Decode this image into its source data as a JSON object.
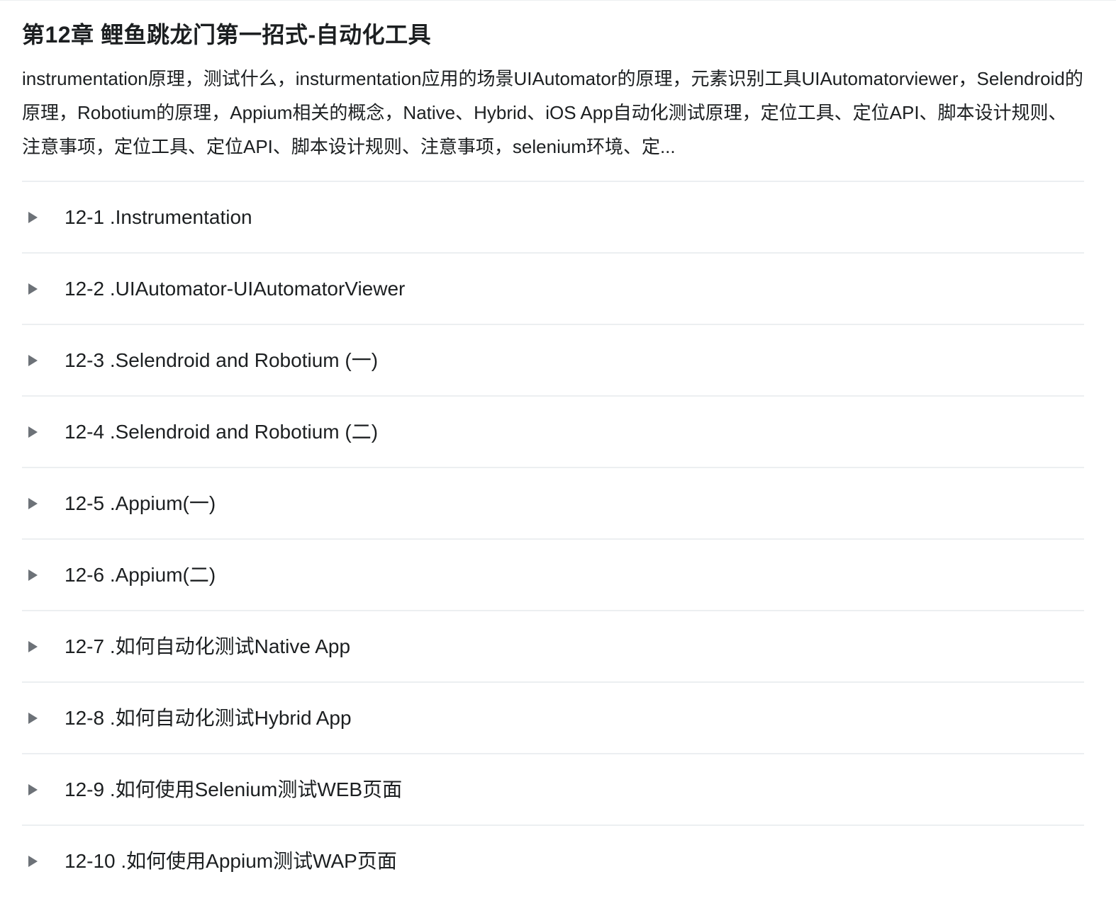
{
  "chapter": {
    "title": "第12章 鲤鱼跳龙门第一招式-自动化工具",
    "description": "instrumentation原理，测试什么，insturmentation应用的场景UIAutomator的原理，元素识别工具UIAutomatorviewer，Selendroid的原理，Robotium的原理，Appium相关的概念，Native、Hybrid、iOS App自动化测试原理，定位工具、定位API、脚本设计规则、注意事项，定位工具、定位API、脚本设计规则、注意事项，selenium环境、定..."
  },
  "lessons": [
    {
      "label": "12-1 .Instrumentation",
      "icon": "play-caret-icon"
    },
    {
      "label": "12-2 .UIAutomator-UIAutomatorViewer",
      "icon": "play-caret-icon"
    },
    {
      "label": "12-3 .Selendroid and Robotium (一)",
      "icon": "play-caret-icon"
    },
    {
      "label": "12-4 .Selendroid and Robotium (二)",
      "icon": "play-caret-icon"
    },
    {
      "label": "12-5 .Appium(一)",
      "icon": "play-caret-icon"
    },
    {
      "label": "12-6 .Appium(二)",
      "icon": "play-caret-icon"
    },
    {
      "label": "12-7 .如何自动化测试Native App",
      "icon": "play-caret-icon"
    },
    {
      "label": "12-8 .如何自动化测试Hybrid App",
      "icon": "play-caret-icon"
    },
    {
      "label": "12-9 .如何使用Selenium测试WEB页面",
      "icon": "play-caret-icon"
    },
    {
      "label": "12-10 .如何使用Appium测试WAP页面",
      "icon": "play-caret-icon"
    }
  ],
  "colors": {
    "text": "#1c1f21",
    "divider": "#eceff1",
    "caret": "#6d7278"
  }
}
